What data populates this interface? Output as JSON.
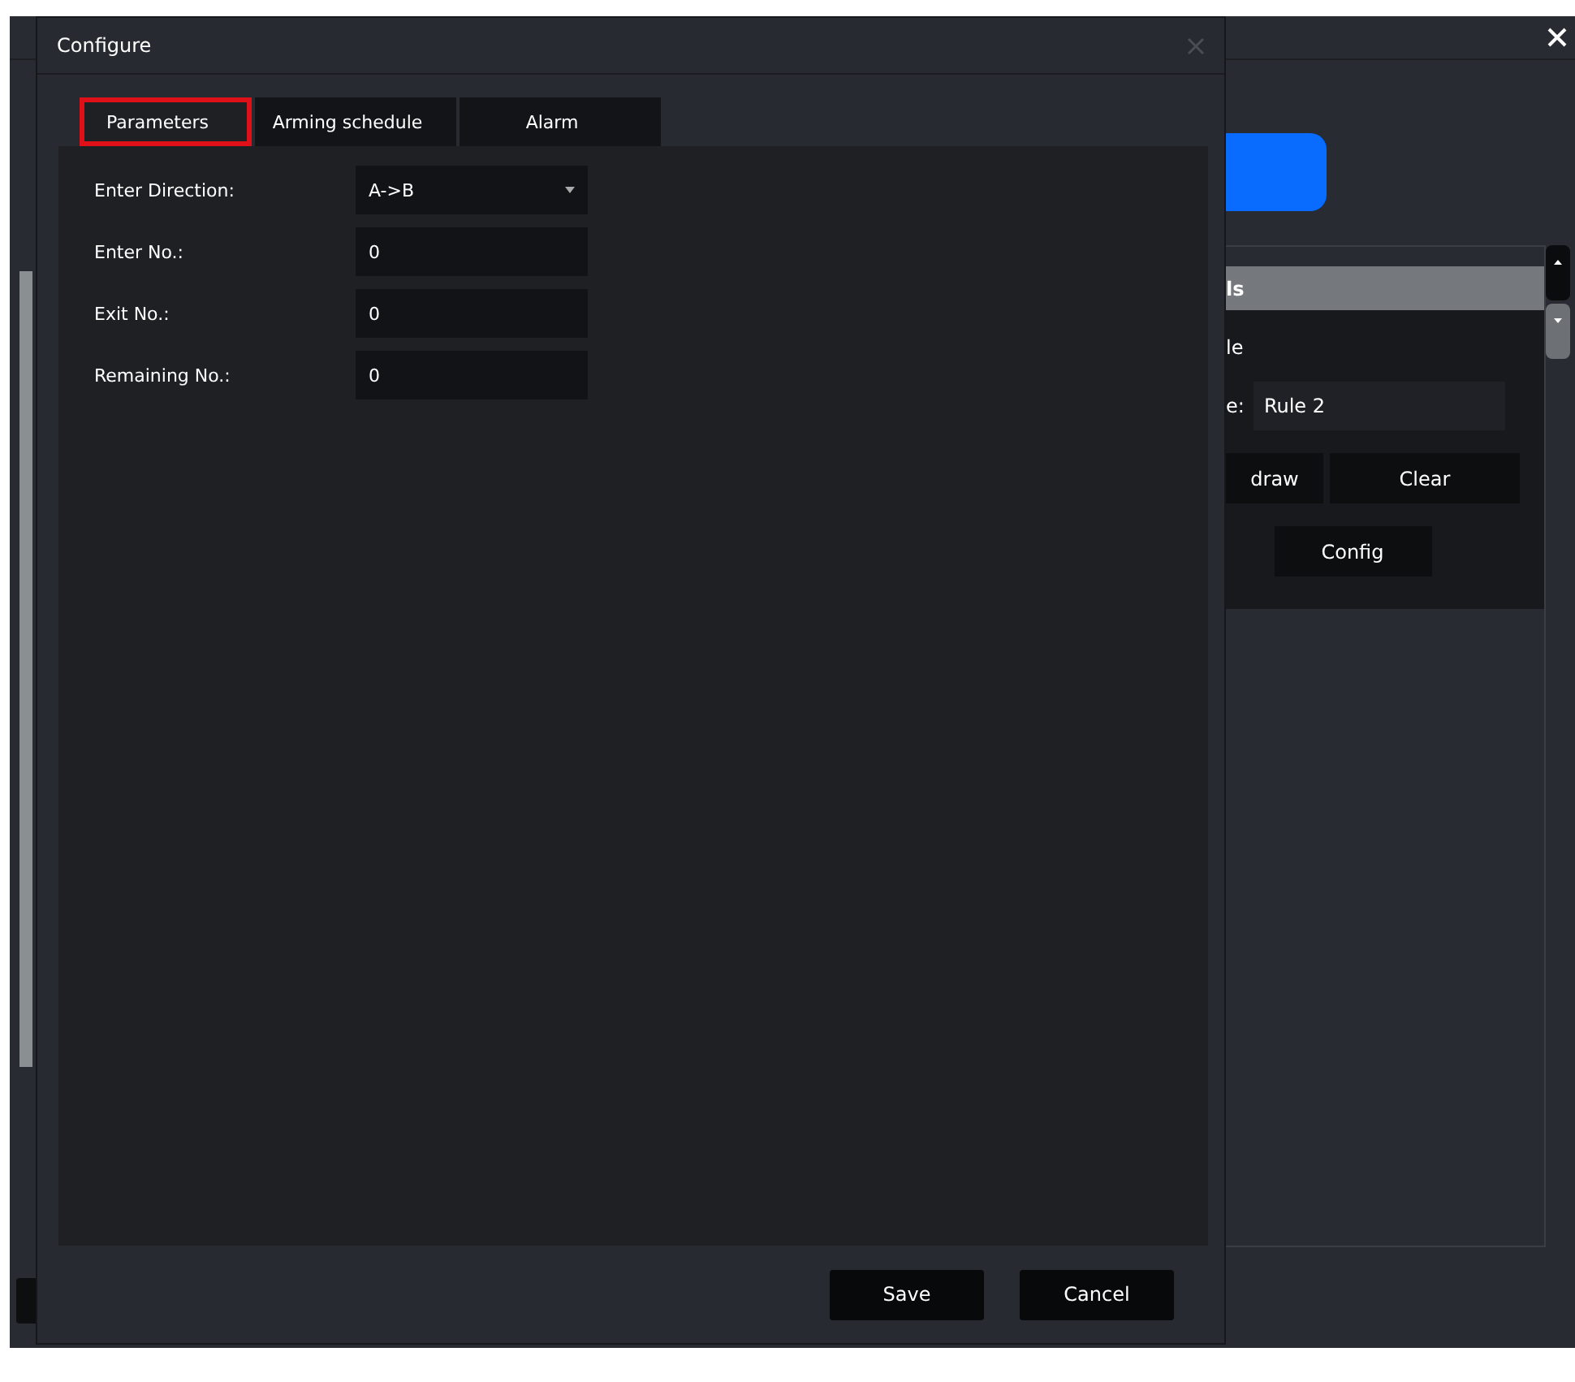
{
  "background": {
    "panel": {
      "header": "ls",
      "line": "le",
      "name_label": "e:",
      "name_value": "Rule 2",
      "buttons": [
        "draw",
        "Clear"
      ],
      "config_button": "Config"
    }
  },
  "dialog": {
    "title": "Configure",
    "tabs": [
      {
        "label": "Parameters",
        "selected": true
      },
      {
        "label": "Arming schedule",
        "selected": false
      },
      {
        "label": "Alarm",
        "selected": false
      }
    ],
    "fields": [
      {
        "label": "Enter Direction:",
        "value": "A->B",
        "kind": "dropdown"
      },
      {
        "label": "Enter No.:",
        "value": "0",
        "kind": "text"
      },
      {
        "label": "Exit No.:",
        "value": "0",
        "kind": "text"
      },
      {
        "label": "Remaining No.:",
        "value": "0",
        "kind": "text"
      }
    ],
    "buttons": [
      "Save",
      "Cancel"
    ]
  }
}
